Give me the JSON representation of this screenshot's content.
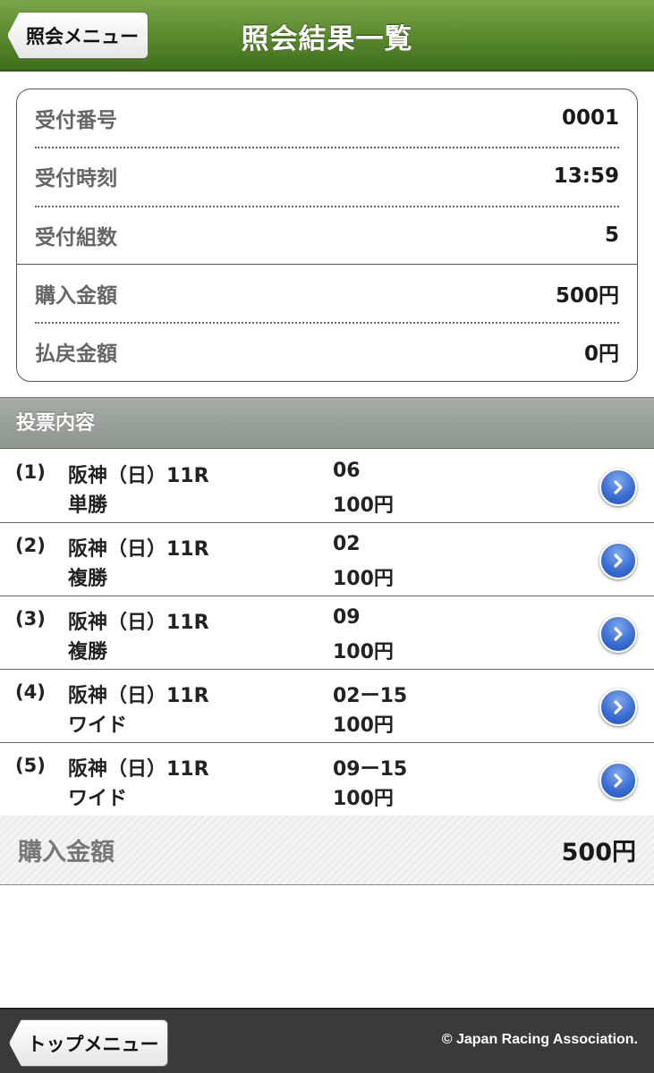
{
  "header": {
    "title": "照会結果一覧",
    "back_label": "照会メニュー"
  },
  "info": {
    "receipt_number": {
      "label": "受付番号",
      "value": "0001"
    },
    "receipt_time": {
      "label": "受付時刻",
      "value": "13:59"
    },
    "receipt_sets": {
      "label": "受付組数",
      "value": "5"
    },
    "purchase_amount": {
      "label": "購入金額",
      "value": "500円"
    },
    "payout_amount": {
      "label": "払戻金額",
      "value": "0円"
    }
  },
  "section": {
    "title": "投票内容"
  },
  "bets": [
    {
      "no": "(1)",
      "race": "阪神（日）11R",
      "type": "単勝",
      "numbers": "06",
      "amount": "100円"
    },
    {
      "no": "(2)",
      "race": "阪神（日）11R",
      "type": "複勝",
      "numbers": "02",
      "amount": "100円"
    },
    {
      "no": "(3)",
      "race": "阪神（日）11R",
      "type": "複勝",
      "numbers": "09",
      "amount": "100円"
    },
    {
      "no": "(4)",
      "race": "阪神（日）11R",
      "type": "ワイド",
      "numbers": "02ー15",
      "amount": "100円"
    },
    {
      "no": "(5)",
      "race": "阪神（日）11R",
      "type": "ワイド",
      "numbers": "09ー15",
      "amount": "100円"
    }
  ],
  "total": {
    "label": "購入金額",
    "value": "500円"
  },
  "footer": {
    "top_menu_label": "トップメニュー",
    "copyright": "© Japan Racing Association."
  },
  "colors": {
    "header_green": "#5b8a2e",
    "section_gray": "#9a9f9a",
    "chevron_blue": "#3c6fd4",
    "footer_dark": "#3a3a3a"
  },
  "icons": {
    "row_action": "chevron-right-icon"
  }
}
